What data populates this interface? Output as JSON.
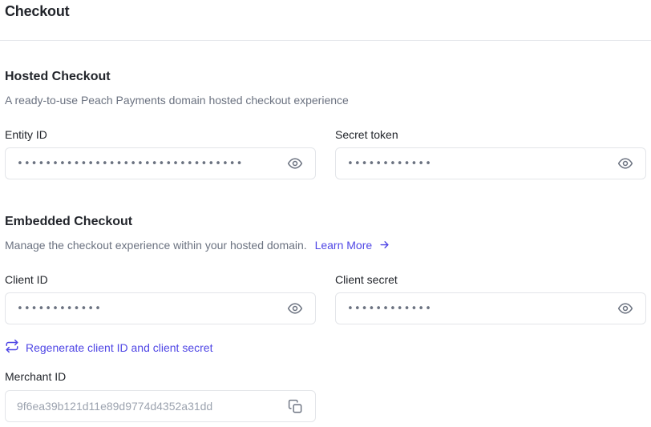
{
  "header": {
    "title": "Checkout"
  },
  "hosted": {
    "title": "Hosted Checkout",
    "description": "A ready-to-use Peach Payments domain hosted checkout experience",
    "entity_id": {
      "label": "Entity ID",
      "value": "••••••••••••••••••••••••••••••••"
    },
    "secret_token": {
      "label": "Secret token",
      "value": "••••••••••••"
    }
  },
  "embedded": {
    "title": "Embedded Checkout",
    "description": "Manage the checkout experience within your hosted domain.",
    "learn_more": "Learn More",
    "client_id": {
      "label": "Client ID",
      "value": "••••••••••••"
    },
    "client_secret": {
      "label": "Client secret",
      "value": "••••••••••••"
    },
    "regenerate_label": "Regenerate client ID and client secret",
    "merchant_id": {
      "label": "Merchant ID",
      "value": "9f6ea39b121d11e89d9774d4352a31dd"
    }
  },
  "icons": {
    "reveal": "eye-icon",
    "copy": "copy-icon",
    "regenerate": "refresh-arrows-icon",
    "arrow": "arrow-right-icon"
  },
  "colors": {
    "accent": "#4f46e5",
    "muted_text": "#6b7280",
    "border": "#e3e5e9"
  }
}
